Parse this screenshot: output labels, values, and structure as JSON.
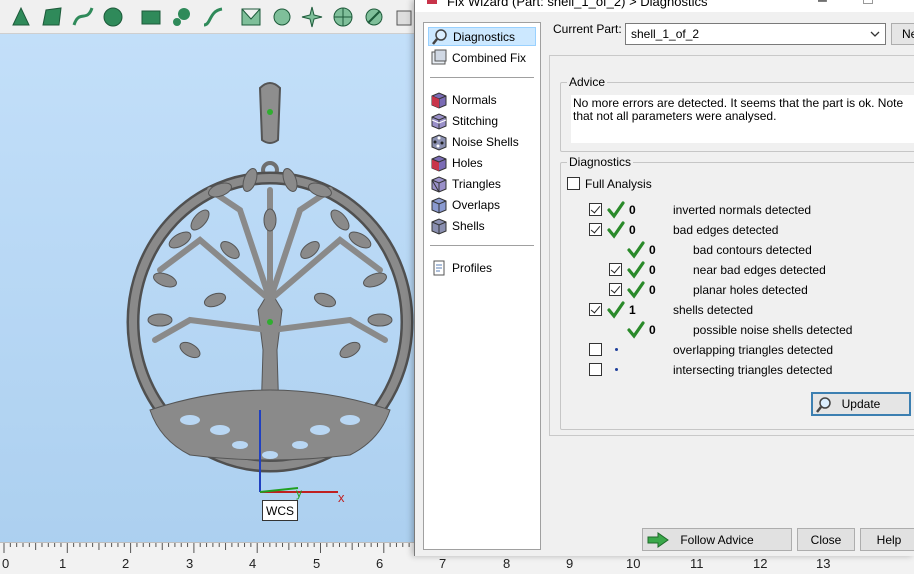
{
  "viewport": {
    "wcs_label": "WCS",
    "axis_x_label": "x",
    "axis_y_label": "y",
    "ruler": {
      "ticks": [
        "0",
        "1",
        "2",
        "3",
        "4",
        "5",
        "6",
        "7",
        "8",
        "9",
        "10",
        "11",
        "12",
        "13"
      ],
      "unit": "cm"
    },
    "toolbar_icons": [
      "select-triangle-icon",
      "select-surface-icon",
      "select-curve-icon",
      "select-shell-icon",
      "select-rectangle-icon",
      "lasso-icon",
      "freehand-icon",
      "mesh-plane-icon",
      "mesh-brush-icon",
      "mesh-star-icon",
      "mesh-circle-icon",
      "mesh-cut-icon",
      "box-icon"
    ]
  },
  "dialog": {
    "title": "Fix Wizard (Part: shell_1_of_2) > Diagnostics",
    "current_part_label": "Current Part:",
    "current_part_value": "shell_1_of_2",
    "next_button": "Ne",
    "nav": [
      {
        "label": "Diagnostics",
        "icon": "magnifier-icon",
        "selected": true
      },
      {
        "label": "Combined Fix",
        "icon": "combined-fix-icon",
        "selected": false
      },
      {
        "label": "Normals",
        "icon": "cube-normals-icon",
        "selected": false
      },
      {
        "label": "Stitching",
        "icon": "cube-stitching-icon",
        "selected": false
      },
      {
        "label": "Noise Shells",
        "icon": "cube-noise-icon",
        "selected": false
      },
      {
        "label": "Holes",
        "icon": "cube-holes-icon",
        "selected": false
      },
      {
        "label": "Triangles",
        "icon": "cube-triangles-icon",
        "selected": false
      },
      {
        "label": "Overlaps",
        "icon": "cube-overlaps-icon",
        "selected": false
      },
      {
        "label": "Shells",
        "icon": "cube-shells-icon",
        "selected": false
      },
      {
        "label": "Profiles",
        "icon": "document-icon",
        "selected": false
      }
    ],
    "advice": {
      "title": "Advice",
      "text": "No more errors are detected. It seems that the part is ok. Note that not all parameters were analysed."
    },
    "diagnostics": {
      "title": "Diagnostics",
      "full_analysis_label": "Full Analysis",
      "full_analysis_checked": false,
      "rows": [
        {
          "label": "inverted normals detected",
          "count": "0",
          "checkbox": true,
          "checked": true,
          "status": "ok",
          "indent": 0
        },
        {
          "label": "bad edges detected",
          "count": "0",
          "checkbox": true,
          "checked": true,
          "status": "ok",
          "indent": 0
        },
        {
          "label": "bad contours detected",
          "count": "0",
          "checkbox": false,
          "checked": false,
          "status": "ok",
          "indent": 1
        },
        {
          "label": "near bad edges detected",
          "count": "0",
          "checkbox": true,
          "checked": true,
          "status": "ok",
          "indent": 1
        },
        {
          "label": "planar holes detected",
          "count": "0",
          "checkbox": true,
          "checked": true,
          "status": "ok",
          "indent": 1
        },
        {
          "label": "shells detected",
          "count": "1",
          "checkbox": true,
          "checked": true,
          "status": "ok",
          "indent": 0
        },
        {
          "label": "possible noise shells detected",
          "count": "0",
          "checkbox": false,
          "checked": false,
          "status": "ok",
          "indent": 1
        },
        {
          "label": "overlapping triangles detected",
          "count": "",
          "checkbox": true,
          "checked": false,
          "status": "unknown",
          "indent": 0
        },
        {
          "label": "intersecting triangles detected",
          "count": "",
          "checkbox": true,
          "checked": false,
          "status": "unknown",
          "indent": 0
        }
      ],
      "update_button": "Update"
    },
    "buttons": {
      "follow_advice": "Follow Advice",
      "close": "Close",
      "help": "Help"
    },
    "colors": {
      "tick_green": "#2a8a2a",
      "selection_blue": "#cce8ff",
      "cube_purple": "#7a6bb5",
      "cube_red": "#c8344a"
    }
  }
}
